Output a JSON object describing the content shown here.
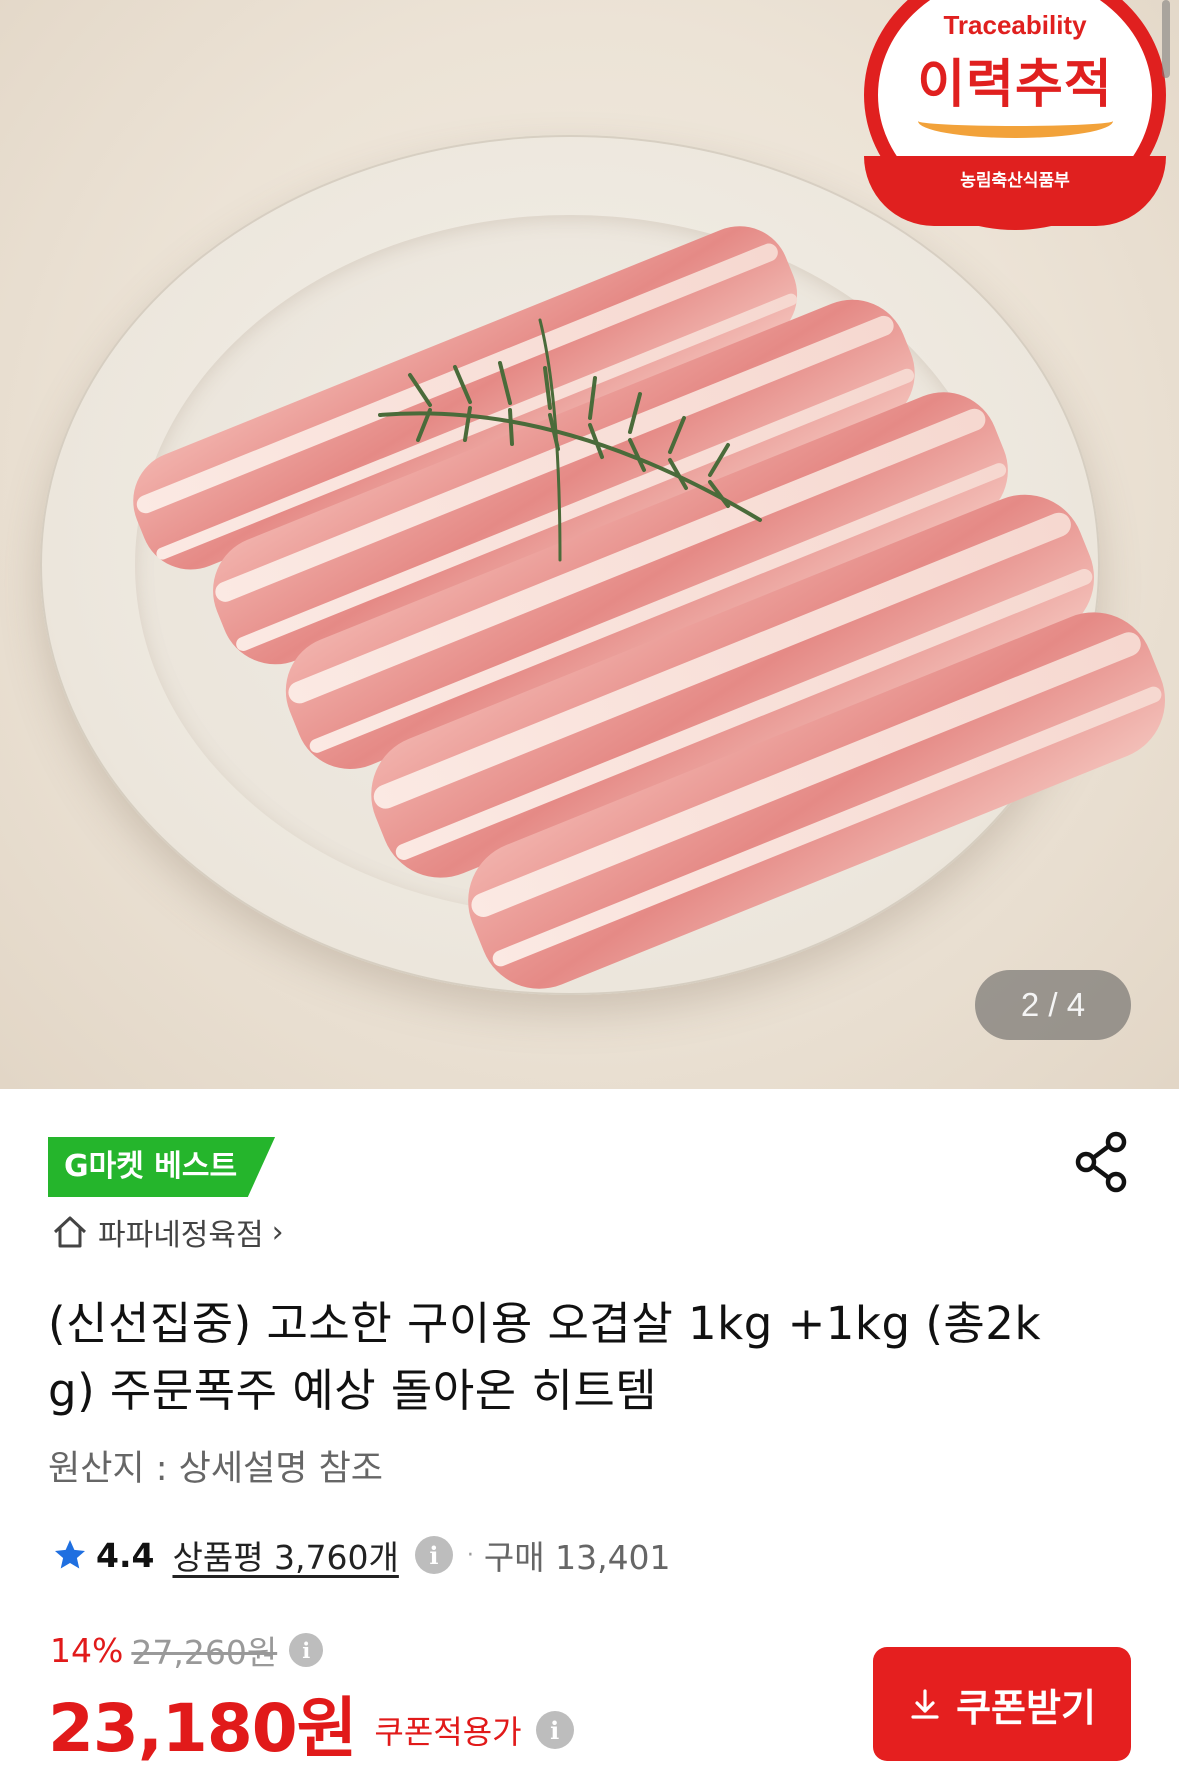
{
  "hero": {
    "traceability_en": "Traceability",
    "traceability_ko": "이력추적",
    "ministry": "농림축산식품부",
    "pager_current": "2",
    "pager_total": "4",
    "pager_text": "2 / 4"
  },
  "badge": {
    "label": "G마켓 베스트"
  },
  "store": {
    "name": "파파네정육점",
    "arrow": "›"
  },
  "product": {
    "title": "(신선집중) 고소한 구이용 오겹살 1kg +1kg (총2kg) 주문폭주 예상 돌아온 히트템",
    "origin": "원산지 : 상세설명 참조"
  },
  "rating": {
    "score": "4.4",
    "reviews_label": "상품평 3,760개",
    "info": "i",
    "separator": "·",
    "purchases": "구매 13,401"
  },
  "pricing": {
    "discount": "14%",
    "original_price": "27,260원",
    "price": "23,180원",
    "price_label": "쿠폰적용가",
    "info": "i"
  },
  "coupon": {
    "label": "쿠폰받기"
  },
  "colors": {
    "accent_red": "#e51f1f",
    "best_green": "#25b52c",
    "star_blue": "#1f6fe0"
  },
  "icons": [
    "share-icon",
    "home-icon",
    "star-icon",
    "info-icon",
    "download-icon"
  ]
}
